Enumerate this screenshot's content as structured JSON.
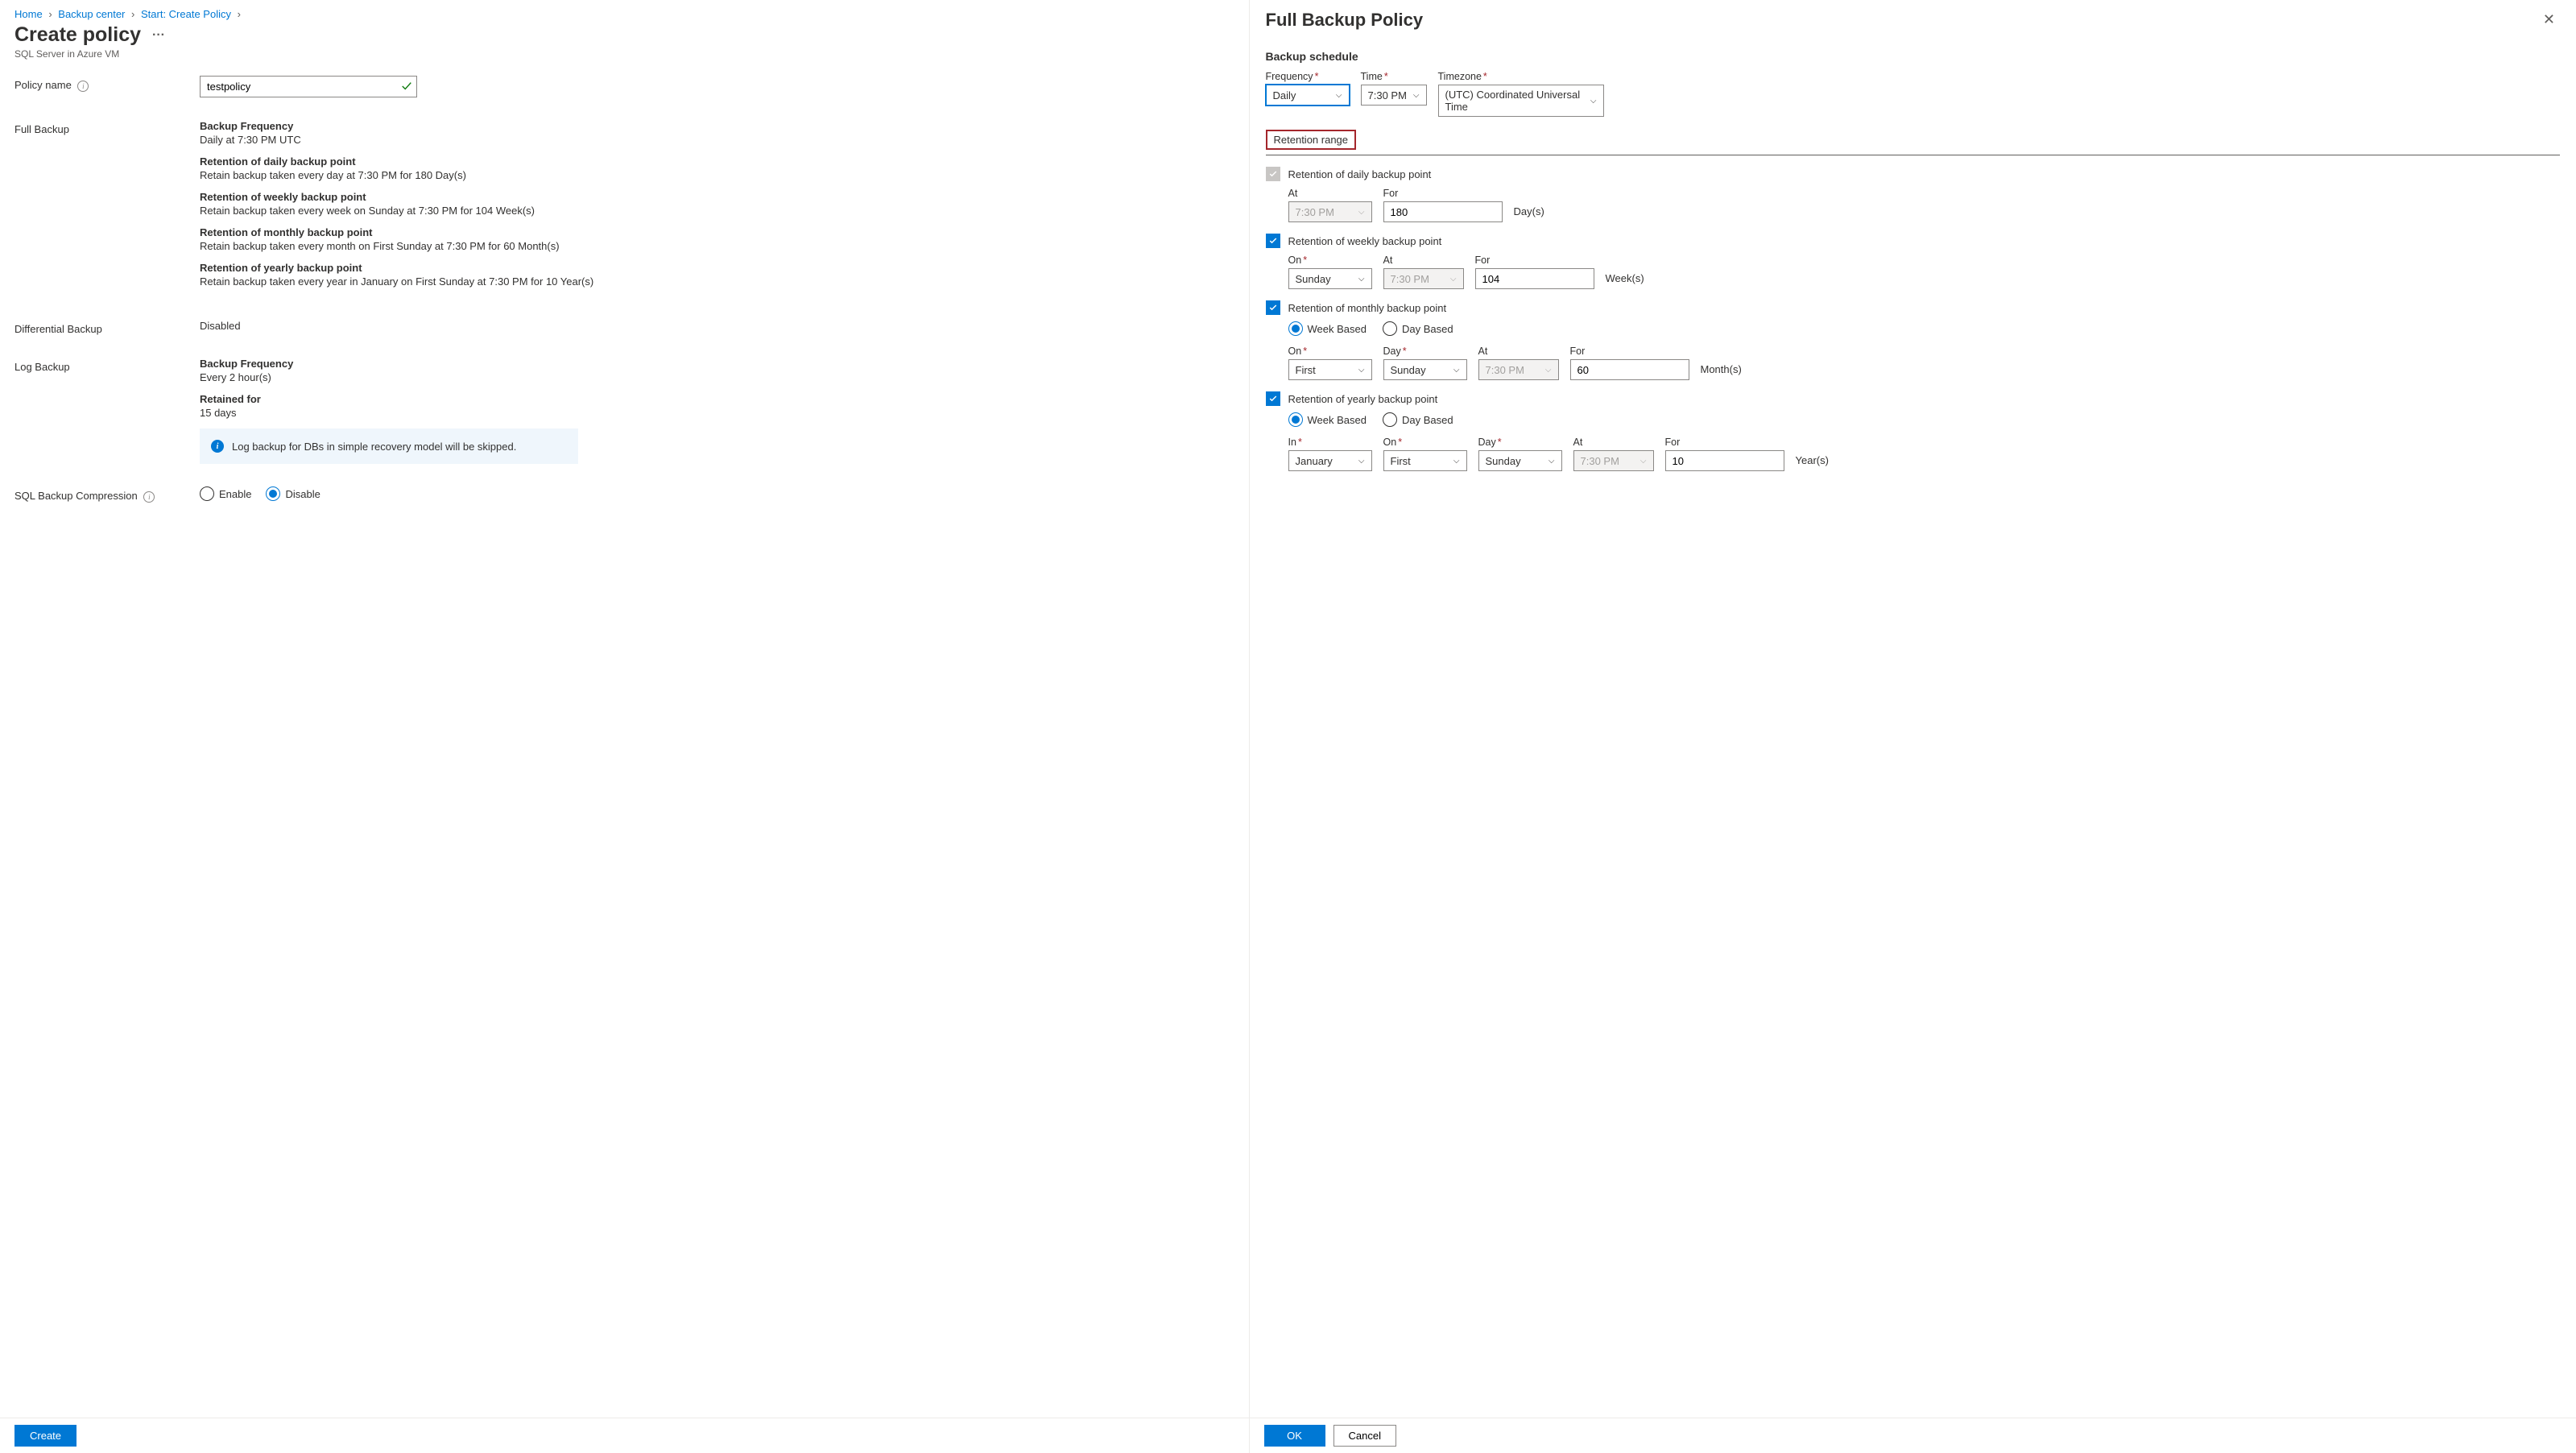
{
  "breadcrumb": {
    "home": "Home",
    "backup_center": "Backup center",
    "start": "Start: Create Policy"
  },
  "left": {
    "title": "Create policy",
    "subtitle": "SQL Server in Azure VM",
    "policy_name_label": "Policy name",
    "policy_name_value": "testpolicy",
    "full_backup_label": "Full Backup",
    "full": {
      "freq_title": "Backup Frequency",
      "freq_text": "Daily at 7:30 PM UTC",
      "daily_title": "Retention of daily backup point",
      "daily_text": "Retain backup taken every day at 7:30 PM for 180 Day(s)",
      "weekly_title": "Retention of weekly backup point",
      "weekly_text": "Retain backup taken every week on Sunday at 7:30 PM for 104 Week(s)",
      "monthly_title": "Retention of monthly backup point",
      "monthly_text": "Retain backup taken every month on First Sunday at 7:30 PM for 60 Month(s)",
      "yearly_title": "Retention of yearly backup point",
      "yearly_text": "Retain backup taken every year in January on First Sunday at 7:30 PM for 10 Year(s)"
    },
    "diff_label": "Differential Backup",
    "diff_value": "Disabled",
    "log_label": "Log Backup",
    "log": {
      "freq_title": "Backup Frequency",
      "freq_text": "Every 2 hour(s)",
      "ret_title": "Retained for",
      "ret_text": "15 days"
    },
    "info_banner": "Log backup for DBs in simple recovery model will be skipped.",
    "compression_label": "SQL Backup Compression",
    "compression_enable": "Enable",
    "compression_disable": "Disable",
    "create_btn": "Create"
  },
  "right": {
    "title": "Full Backup Policy",
    "schedule_title": "Backup schedule",
    "freq_label": "Frequency",
    "freq_value": "Daily",
    "time_label": "Time",
    "time_value": "7:30 PM",
    "tz_label": "Timezone",
    "tz_value": "(UTC) Coordinated Universal Time",
    "retention_title": "Retention range",
    "daily": {
      "label": "Retention of daily backup point",
      "at_label": "At",
      "at_value": "7:30 PM",
      "for_label": "For",
      "for_value": "180",
      "unit": "Day(s)"
    },
    "weekly": {
      "label": "Retention of weekly backup point",
      "on_label": "On",
      "on_value": "Sunday",
      "at_label": "At",
      "at_value": "7:30 PM",
      "for_label": "For",
      "for_value": "104",
      "unit": "Week(s)"
    },
    "monthly": {
      "label": "Retention of monthly backup point",
      "week_based": "Week Based",
      "day_based": "Day Based",
      "on_label": "On",
      "on_value": "First",
      "day_label": "Day",
      "day_value": "Sunday",
      "at_label": "At",
      "at_value": "7:30 PM",
      "for_label": "For",
      "for_value": "60",
      "unit": "Month(s)"
    },
    "yearly": {
      "label": "Retention of yearly backup point",
      "week_based": "Week Based",
      "day_based": "Day Based",
      "in_label": "In",
      "in_value": "January",
      "on_label": "On",
      "on_value": "First",
      "day_label": "Day",
      "day_value": "Sunday",
      "at_label": "At",
      "at_value": "7:30 PM",
      "for_label": "For",
      "for_value": "10",
      "unit": "Year(s)"
    },
    "ok_btn": "OK",
    "cancel_btn": "Cancel"
  }
}
